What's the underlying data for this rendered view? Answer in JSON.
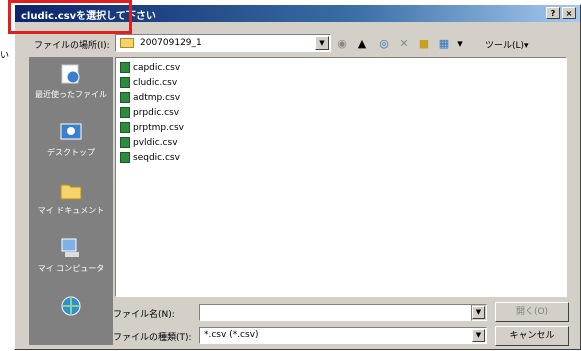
{
  "dialog": {
    "title": "cludic.csvを選択して下さい",
    "help_label": "?",
    "close_label": "×"
  },
  "side_text": "い",
  "toolbar": {
    "look_in_label": "ファイルの場所(I):",
    "folder_value": "200709129_1",
    "tools_label": "ツール(L)▾"
  },
  "places": [
    {
      "label": "最近使ったファイル",
      "icon": "recent-icon"
    },
    {
      "label": "デスクトップ",
      "icon": "desktop-icon"
    },
    {
      "label": "マイ ドキュメント",
      "icon": "documents-icon"
    },
    {
      "label": "マイ コンピュータ",
      "icon": "computer-icon"
    },
    {
      "label": "",
      "icon": "network-icon"
    }
  ],
  "files": [
    "capdic.csv",
    "cludic.csv",
    "adtmp.csv",
    "prpdic.csv",
    "prptmp.csv",
    "pvldic.csv",
    "seqdic.csv"
  ],
  "filename": {
    "label": "ファイル名(N):",
    "value": ""
  },
  "filetype": {
    "label": "ファイルの種類(T):",
    "value": "*.csv (*.csv)"
  },
  "buttons": {
    "open": "開く(O)",
    "cancel": "キャンセル"
  }
}
